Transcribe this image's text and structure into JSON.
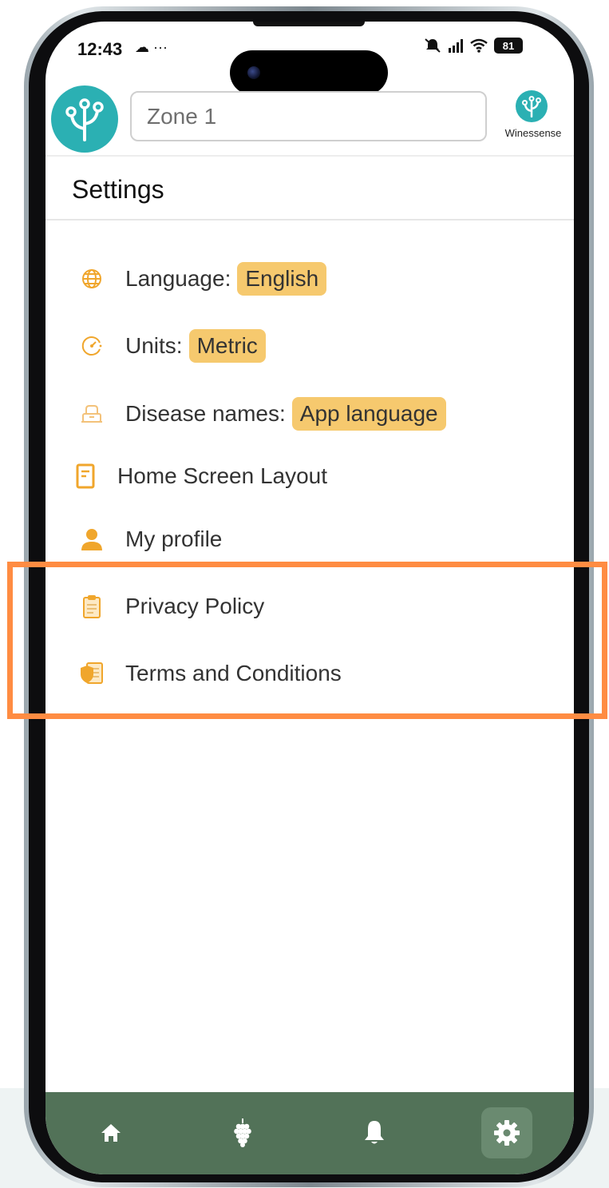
{
  "status_bar": {
    "time": "12:43",
    "extra": "☁ ···",
    "battery": "81"
  },
  "header": {
    "zone_value": "Zone 1",
    "brand_label": "Winessense"
  },
  "page": {
    "title": "Settings"
  },
  "settings": {
    "language_label": "Language:",
    "language_value": "English",
    "units_label": "Units:",
    "units_value": "Metric",
    "disease_label": "Disease names:",
    "disease_value": "App language",
    "home_layout": "Home Screen Layout",
    "profile": "My profile",
    "privacy": "Privacy Policy",
    "terms": "Terms and Conditions"
  },
  "nav": {
    "items": [
      {
        "name": "home-icon",
        "active": false
      },
      {
        "name": "grape-icon",
        "active": false
      },
      {
        "name": "bell-icon",
        "active": false
      },
      {
        "name": "gear-icon",
        "active": true
      }
    ]
  },
  "colors": {
    "accent": "#f6c96e",
    "icon": "#f0a62c",
    "brand_teal": "#2bb0b3",
    "nav_green": "#527258",
    "highlight": "#ff8c42"
  }
}
